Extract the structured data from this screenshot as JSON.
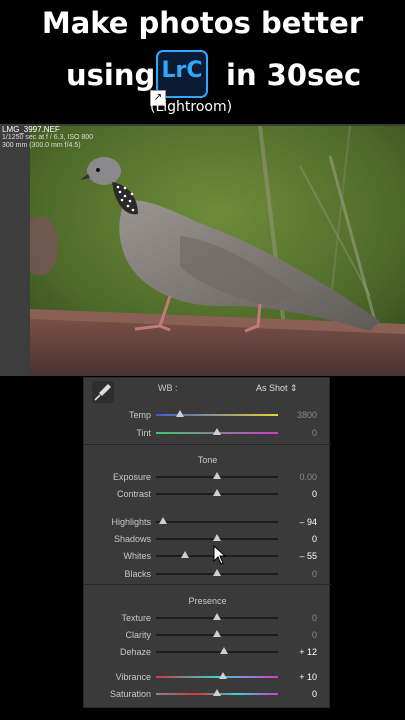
{
  "title": {
    "line1": "Make photos better",
    "line2_left": "using",
    "line2_right": "in 30sec",
    "app_icon_text": "LrC",
    "subtitle": "(Lightroom)"
  },
  "photo_info": {
    "filename": "LMG_3997.NEF",
    "line2": "1/1250 sec at f / 6.3, ISO 800",
    "line3": "300 mm (300.0 mm f/4.5)"
  },
  "panel": {
    "wb_label": "WB :",
    "wb_value": "As Shot ⇕",
    "tone_header": "Tone",
    "presence_header": "Presence",
    "sliders": [
      {
        "key": "temp",
        "label": "Temp",
        "value": "3800",
        "pos": 0.2,
        "active": false
      },
      {
        "key": "tint",
        "label": "Tint",
        "value": "0",
        "pos": 0.5,
        "active": false
      },
      {
        "key": "exposure",
        "label": "Exposure",
        "value": "0.00",
        "pos": 0.5,
        "active": false
      },
      {
        "key": "contrast",
        "label": "Contrast",
        "value": "0",
        "pos": 0.5,
        "active": true
      },
      {
        "key": "highlights",
        "label": "Highlights",
        "value": "– 94",
        "pos": 0.06,
        "active": true
      },
      {
        "key": "shadows",
        "label": "Shadows",
        "value": "0",
        "pos": 0.5,
        "active": true
      },
      {
        "key": "whites",
        "label": "Whites",
        "value": "– 55",
        "pos": 0.24,
        "active": true
      },
      {
        "key": "blacks",
        "label": "Blacks",
        "value": "0",
        "pos": 0.5,
        "active": false
      },
      {
        "key": "texture",
        "label": "Texture",
        "value": "0",
        "pos": 0.5,
        "active": false
      },
      {
        "key": "clarity",
        "label": "Clarity",
        "value": "0",
        "pos": 0.5,
        "active": false
      },
      {
        "key": "dehaze",
        "label": "Dehaze",
        "value": "+ 12",
        "pos": 0.56,
        "active": true
      },
      {
        "key": "vibrance",
        "label": "Vibrance",
        "value": "+ 10",
        "pos": 0.55,
        "active": true
      },
      {
        "key": "saturation",
        "label": "Saturation",
        "value": "0",
        "pos": 0.5,
        "active": true
      }
    ]
  }
}
